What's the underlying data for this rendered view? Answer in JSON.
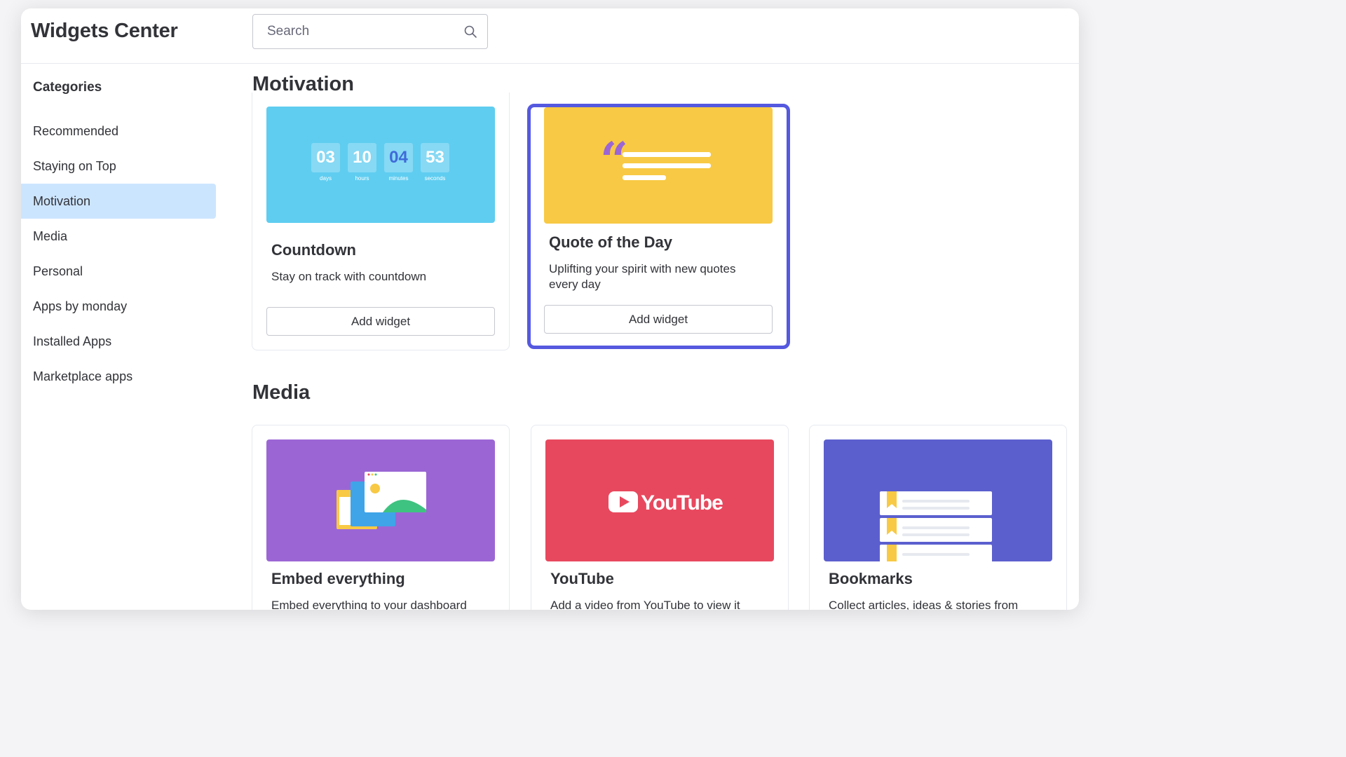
{
  "header": {
    "title": "Widgets Center",
    "search_placeholder": "Search"
  },
  "sidebar": {
    "heading": "Categories",
    "items": [
      {
        "label": "Recommended"
      },
      {
        "label": "Staying on Top"
      },
      {
        "label": "Motivation",
        "active": true
      },
      {
        "label": "Media"
      },
      {
        "label": "Personal"
      },
      {
        "label": "Apps by monday"
      },
      {
        "label": "Installed Apps"
      },
      {
        "label": "Marketplace apps"
      }
    ]
  },
  "sections": {
    "motivation": {
      "title": "Motivation",
      "cards": [
        {
          "title": "Countdown",
          "description": "Stay on track with countdown",
          "button": "Add widget",
          "image_color": "#5fcdf0",
          "countdown": [
            {
              "value": "03",
              "label": "days"
            },
            {
              "value": "10",
              "label": "hours"
            },
            {
              "value": "04",
              "label": "minutes"
            },
            {
              "value": "53",
              "label": "seconds"
            }
          ]
        },
        {
          "title": "Quote of the Day",
          "description": "Uplifting your spirit with new quotes every day",
          "button": "Add widget",
          "image_color": "#f8c944",
          "selected": true
        }
      ]
    },
    "media": {
      "title": "Media",
      "cards": [
        {
          "title": "Embed everything",
          "description": "Embed everything to your dashboard",
          "image_color": "#9b66d4"
        },
        {
          "title": "YouTube",
          "description": "Add a video from YouTube to view it",
          "image_color": "#e8485e",
          "logo_text": "YouTube"
        },
        {
          "title": "Bookmarks",
          "description": "Collect articles, ideas & stories from",
          "image_color": "#5b5fce"
        }
      ]
    }
  },
  "colors": {
    "accent": "#5559df",
    "active_nav": "#cce5ff"
  }
}
